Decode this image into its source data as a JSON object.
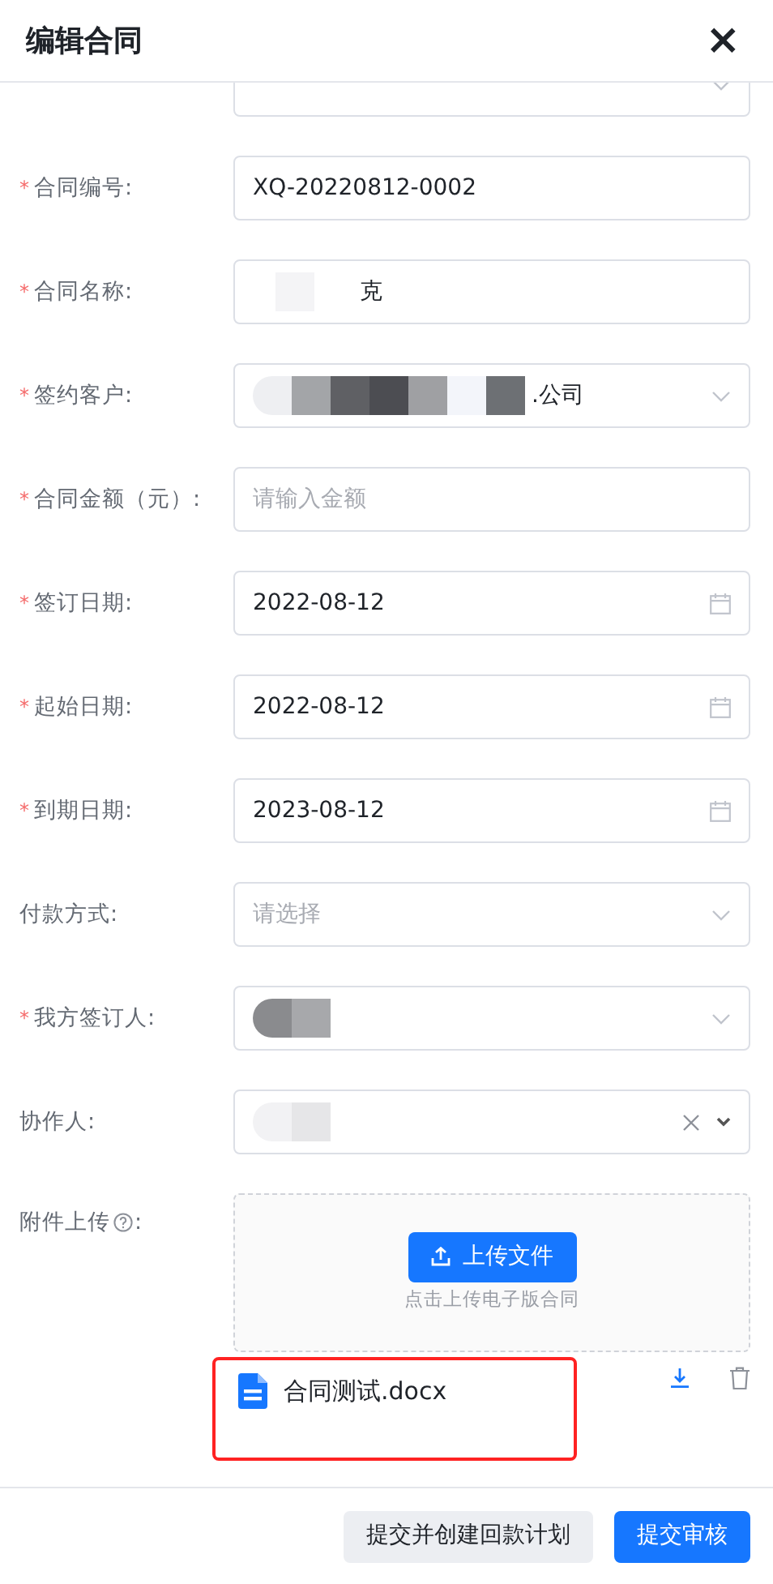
{
  "dialog": {
    "title": "编辑合同",
    "close": "×"
  },
  "fields": [
    {
      "kind": "select",
      "redacted": false
    },
    {
      "required_mark": "*",
      "label": "合同编号:",
      "kind": "input",
      "value": "XQ-20220812-0002",
      "redacted": false
    },
    {
      "required_mark": "*",
      "label": "合同名称:",
      "kind": "input",
      "value": "克",
      "redacted": true
    },
    {
      "required_mark": "*",
      "label": "签约客户:",
      "kind": "select",
      "value": ".公司",
      "redacted": true
    },
    {
      "required_mark": "*",
      "label": "合同金额（元）:",
      "kind": "input",
      "placeholder": "请输入金额",
      "redacted": false
    },
    {
      "required_mark": "*",
      "label": "签订日期:",
      "kind": "date",
      "value": "2022-08-12",
      "redacted": false
    },
    {
      "required_mark": "*",
      "label": "起始日期:",
      "kind": "date",
      "value": "2022-08-12",
      "redacted": false
    },
    {
      "required_mark": "*",
      "label": "到期日期:",
      "kind": "date",
      "value": "2023-08-12",
      "redacted": false
    },
    {
      "label": "付款方式:",
      "kind": "select",
      "placeholder": "请选择",
      "redacted": false
    },
    {
      "required_mark": "*",
      "label": "我方签订人:",
      "kind": "select",
      "redacted": true
    },
    {
      "label": "协作人:",
      "kind": "multiselect",
      "redacted": true
    }
  ],
  "upload": {
    "label": "附件上传",
    "suffix": ":",
    "button": "上传文件",
    "hint": "点击上传电子版合同",
    "files": [
      {
        "name": "合同测试.docx",
        "highlighted": true
      }
    ]
  },
  "footer": {
    "buttons": [
      {
        "label": "提交并创建回款计划",
        "kind": "secondary"
      },
      {
        "label": "提交审核",
        "kind": "primary"
      }
    ]
  }
}
